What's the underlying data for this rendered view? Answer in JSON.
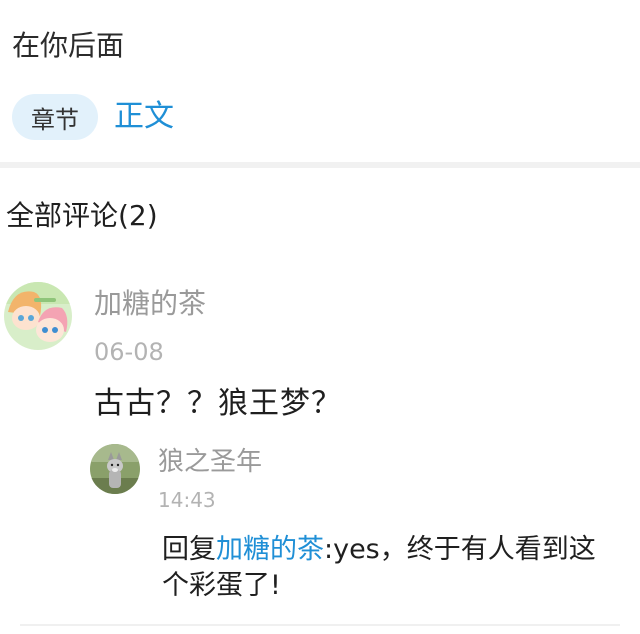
{
  "chapter": {
    "title": "在你后面"
  },
  "tags": {
    "pill_label": "章节",
    "link_label": "正文"
  },
  "comments": {
    "header": "全部评论(2)",
    "items": [
      {
        "username": "加糖的茶",
        "date": "06-08",
        "text": "古古？？狼王梦？",
        "avatar_icon": "anime-girls-avatar",
        "replies": [
          {
            "username": "狼之圣年",
            "time": "14:43",
            "reply_prefix": "回复",
            "mention": "加糖的茶",
            "text_line1": ":yes，终于有人看到这",
            "text_line2": "个彩蛋了!",
            "avatar_icon": "wolf-avatar"
          }
        ]
      }
    ]
  },
  "colors": {
    "accent": "#1f8fd6",
    "pill_bg": "#e2f1fb",
    "muted_text": "#9a9a9a"
  }
}
